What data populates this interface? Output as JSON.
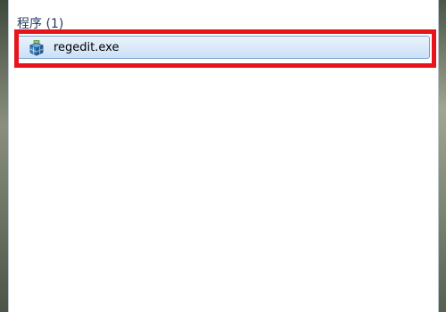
{
  "search_results": {
    "group_header": "程序 (1)",
    "items": [
      {
        "label": "regedit.exe",
        "icon": "regedit-icon",
        "selected": true
      }
    ]
  },
  "annotation": {
    "highlight_color": "#e8141c"
  },
  "colors": {
    "header_text": "#1e395b",
    "selection_border": "#7da2ce",
    "selection_fill": "#dbe9f9"
  }
}
